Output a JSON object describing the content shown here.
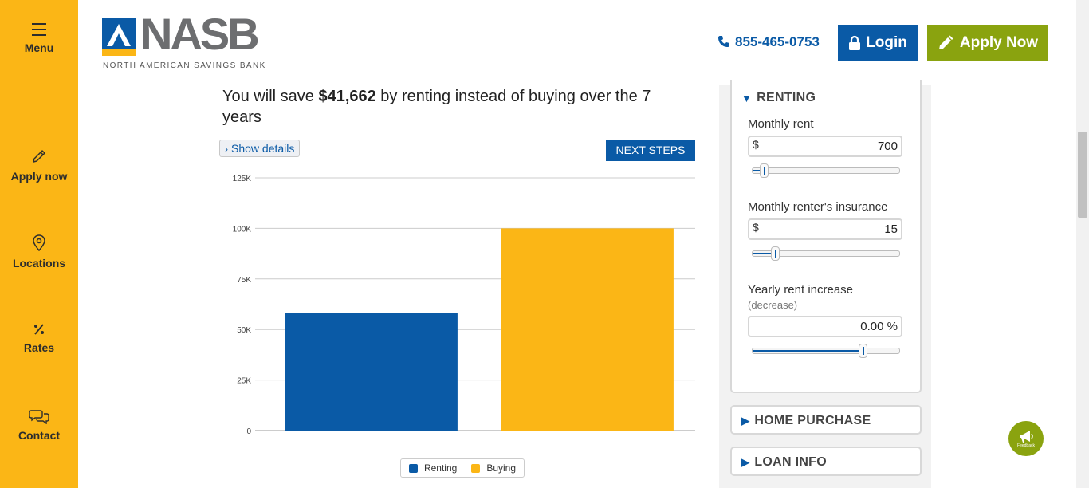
{
  "sidebar": {
    "items": [
      {
        "label": "Menu",
        "icon": "hamburger-icon"
      },
      {
        "label": "Apply now",
        "icon": "pencil-icon"
      },
      {
        "label": "Locations",
        "icon": "map-pin-icon"
      },
      {
        "label": "Rates",
        "icon": "percent-icon"
      },
      {
        "label": "Contact",
        "icon": "chat-bubbles-icon"
      }
    ]
  },
  "header": {
    "logo_text": "NASB",
    "logo_subtitle": "NORTH AMERICAN SAVINGS BANK",
    "phone": "855-465-0753",
    "login_label": "Login",
    "apply_label": "Apply Now"
  },
  "main": {
    "headline_pre": "You will save ",
    "headline_amount": "$41,662",
    "headline_post": " by renting instead of buying over the 7 years",
    "show_details_label": "Show details",
    "next_steps_label": "NEXT STEPS"
  },
  "chart_data": {
    "type": "bar",
    "categories": [
      "Renting",
      "Buying"
    ],
    "values": [
      58000,
      100000
    ],
    "colors": [
      "#0a5aa6",
      "#fbb616"
    ],
    "ylim": [
      0,
      125000
    ],
    "yticks": [
      {
        "value": 0,
        "label": "0"
      },
      {
        "value": 25000,
        "label": "25K"
      },
      {
        "value": 50000,
        "label": "50K"
      },
      {
        "value": 75000,
        "label": "75K"
      },
      {
        "value": 100000,
        "label": "100K"
      },
      {
        "value": 125000,
        "label": "125K"
      }
    ],
    "grid": true,
    "legend": {
      "placement": "bottom",
      "entries": [
        "Renting",
        "Buying"
      ]
    }
  },
  "renting_panel": {
    "title": "RENTING",
    "fields": [
      {
        "label": "Monthly rent",
        "prefix": "$",
        "value": "700",
        "slider_fraction": 0.05
      },
      {
        "label": "Monthly renter's insurance",
        "prefix": "$",
        "value": "15",
        "slider_fraction": 0.13
      },
      {
        "label": "Yearly rent increase",
        "sublabel": "(decrease)",
        "prefix": "",
        "value": "0.00 %",
        "slider_fraction": 0.76
      }
    ]
  },
  "collapsed_panels": [
    {
      "title": "HOME PURCHASE"
    },
    {
      "title": "LOAN INFO"
    }
  ],
  "feedback": {
    "label": "Feedback"
  },
  "colors": {
    "brand_blue": "#0a5aa6",
    "brand_yellow": "#fbb616",
    "brand_green": "#8aa30f"
  }
}
